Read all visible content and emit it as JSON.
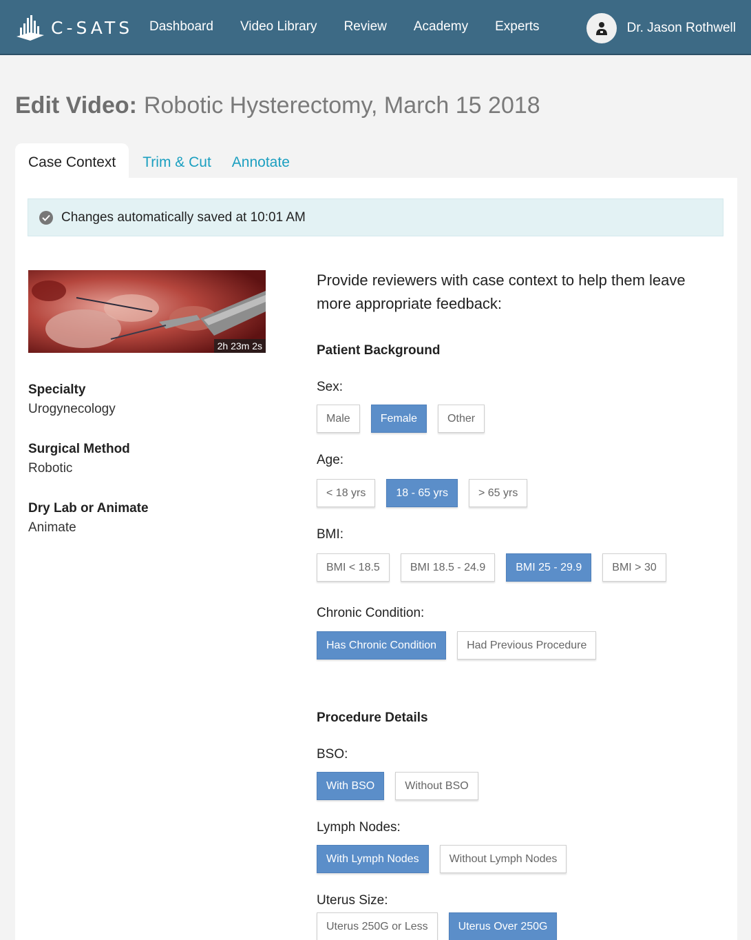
{
  "brand": {
    "name": "C-SATS"
  },
  "nav": {
    "items": [
      "Dashboard",
      "Video Library",
      "Review",
      "Academy",
      "Experts"
    ]
  },
  "user": {
    "name": "Dr. Jason Rothwell"
  },
  "page": {
    "title_label": "Edit Video:",
    "title_value": "Robotic Hysterectomy, March 15 2018"
  },
  "tabs": [
    "Case Context",
    "Trim & Cut",
    "Annotate"
  ],
  "banner": {
    "text": "Changes automatically saved at 10:01 AM"
  },
  "video": {
    "duration": "2h 23m 2s"
  },
  "meta": [
    {
      "label": "Specialty",
      "value": "Urogynecology"
    },
    {
      "label": "Surgical Method",
      "value": "Robotic"
    },
    {
      "label": "Dry Lab or Animate",
      "value": "Animate"
    }
  ],
  "intro": "Provide reviewers with case context to help them leave more appropriate feedback:",
  "sections": {
    "patient": "Patient Background",
    "procedure": "Procedure Details"
  },
  "fields": {
    "sex": {
      "label": "Sex:",
      "options": [
        "Male",
        "Female",
        "Other"
      ],
      "selected": "Female"
    },
    "age": {
      "label": "Age:",
      "options": [
        "< 18 yrs",
        "18 - 65 yrs",
        "> 65 yrs"
      ],
      "selected": "18 - 65 yrs"
    },
    "bmi": {
      "label": "BMI:",
      "options": [
        "BMI < 18.5",
        "BMI 18.5 - 24.9",
        "BMI 25 - 29.9",
        "BMI > 30"
      ],
      "selected": "BMI 25 - 29.9"
    },
    "chronic": {
      "label": "Chronic Condition:",
      "options": [
        "Has Chronic Condition",
        "Had Previous Procedure"
      ],
      "selected": "Has Chronic Condition"
    },
    "bso": {
      "label": "BSO:",
      "options": [
        "With BSO",
        "Without BSO"
      ],
      "selected": "With BSO"
    },
    "lymph": {
      "label": "Lymph Nodes:",
      "options": [
        "With Lymph Nodes",
        "Without Lymph Nodes"
      ],
      "selected": "With Lymph Nodes"
    },
    "uterus": {
      "label": "Uterus Size:",
      "options": [
        "Uterus 250G or Less",
        "Uterus Over 250G"
      ],
      "selected": "Uterus Over 250G"
    }
  }
}
